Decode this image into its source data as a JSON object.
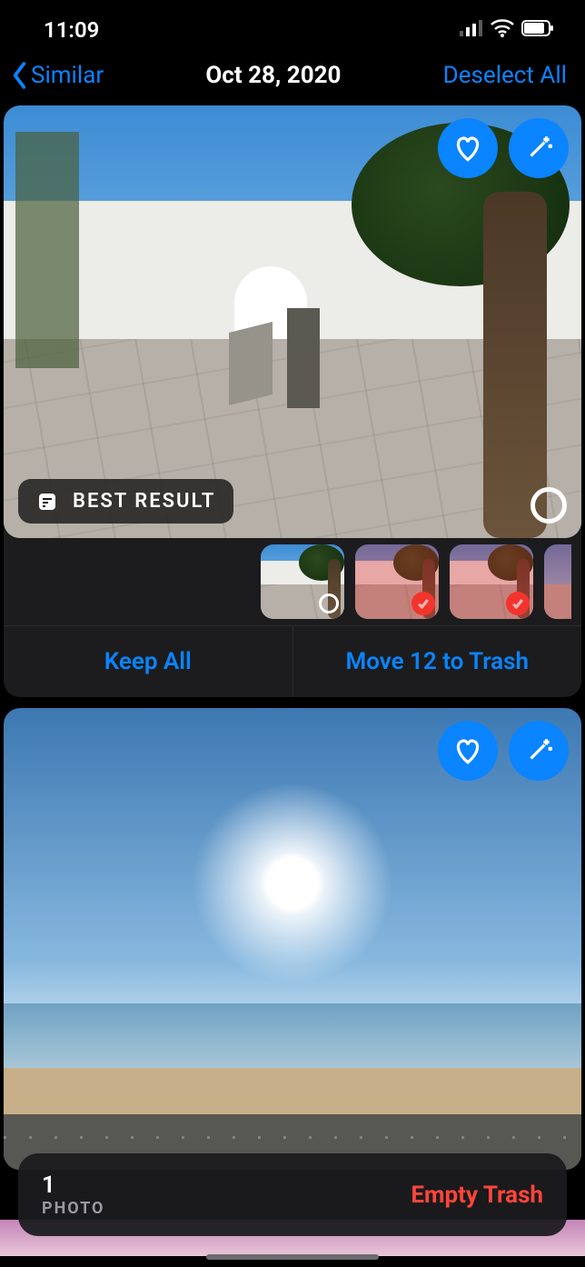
{
  "status": {
    "time": "11:09"
  },
  "nav": {
    "back_label": "Similar",
    "title": "Oct 28, 2020",
    "right_label": "Deselect All"
  },
  "card1": {
    "best_result_label": "BEST RESULT",
    "actions": {
      "keep_all": "Keep All",
      "move_to_trash": "Move 12 to Trash"
    },
    "thumbs": [
      {
        "selected": false
      },
      {
        "selected": true
      },
      {
        "selected": true
      },
      {
        "selected": true,
        "partial": true
      }
    ]
  },
  "trash_bar": {
    "count": "1",
    "label": "PHOTO",
    "action": "Empty Trash"
  },
  "colors": {
    "accent": "#0a84ff",
    "danger": "#ff453a"
  }
}
